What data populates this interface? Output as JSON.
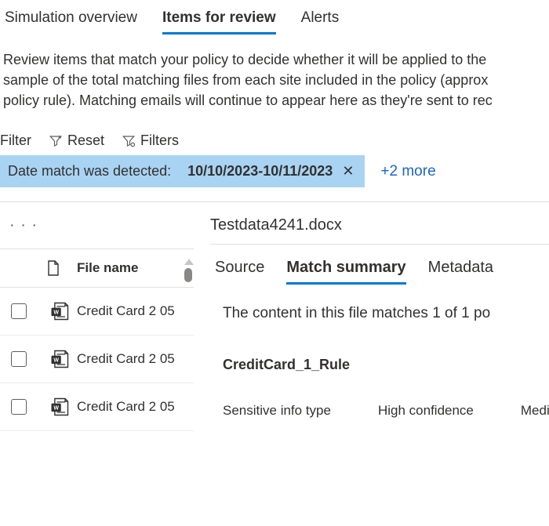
{
  "tabs": {
    "overview": "Simulation overview",
    "items": "Items for review",
    "alerts": "Alerts"
  },
  "description": {
    "line1": "Review items that match your policy to decide whether it will be applied to the",
    "line2": "sample of the total matching files from each site included in the policy (approx",
    "line3": "policy rule). Matching emails will continue to appear here as they're sent to rec"
  },
  "toolbar": {
    "filter": "Filter",
    "reset": "Reset",
    "filters": "Filters"
  },
  "chip": {
    "label": "Date match was detected:",
    "value": "10/10/2023-10/11/2023",
    "more": "+2 more"
  },
  "left": {
    "column_header": "File name",
    "rows": [
      "Credit Card 2 05",
      "Credit Card 2 05",
      "Credit Card 2 05"
    ]
  },
  "right": {
    "file_title": "Testdata4241.docx",
    "sub_tabs": {
      "source": "Source",
      "match": "Match summary",
      "meta": "Metadata"
    },
    "match_text": "The content in this file matches 1 of 1 po",
    "rule_name": "CreditCard_1_Rule",
    "th1": "Sensitive info type",
    "th2": "High confidence",
    "th3": "Mediur"
  }
}
